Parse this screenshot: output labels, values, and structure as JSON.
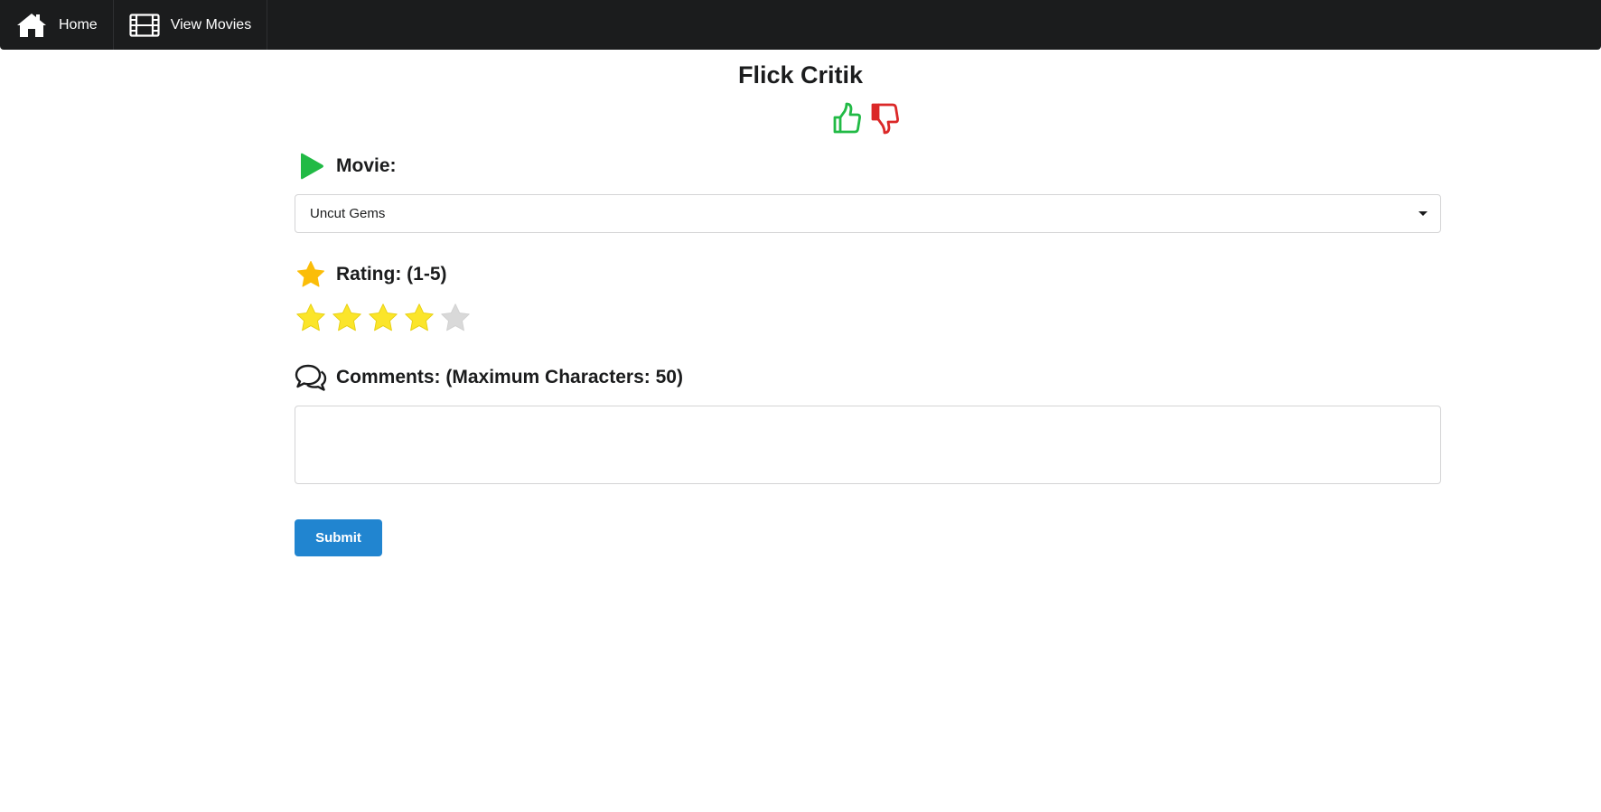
{
  "nav": {
    "items": [
      {
        "label": "Home",
        "icon": "home-icon"
      },
      {
        "label": "View Movies",
        "icon": "film-icon"
      }
    ]
  },
  "header": {
    "title": "Flick Critik",
    "thumbs_up_color": "#21ba45",
    "thumbs_down_color": "#db2828"
  },
  "form": {
    "movie": {
      "label": "Movie:",
      "icon": "play-icon",
      "selected": "Uncut Gems"
    },
    "rating": {
      "label": "Rating: (1-5)",
      "icon": "star-icon",
      "value": 4,
      "max": 5
    },
    "comments": {
      "label": "Comments: (Maximum Characters: 50)",
      "icon": "comments-icon",
      "value": ""
    },
    "submit_label": "Submit"
  },
  "colors": {
    "nav_bg": "#1b1c1d",
    "primary": "#2185d0",
    "play": "#21ba45",
    "star_filled": "#fbe52a",
    "star_empty": "#d9d9d9",
    "label_star": "#fbbd08"
  }
}
